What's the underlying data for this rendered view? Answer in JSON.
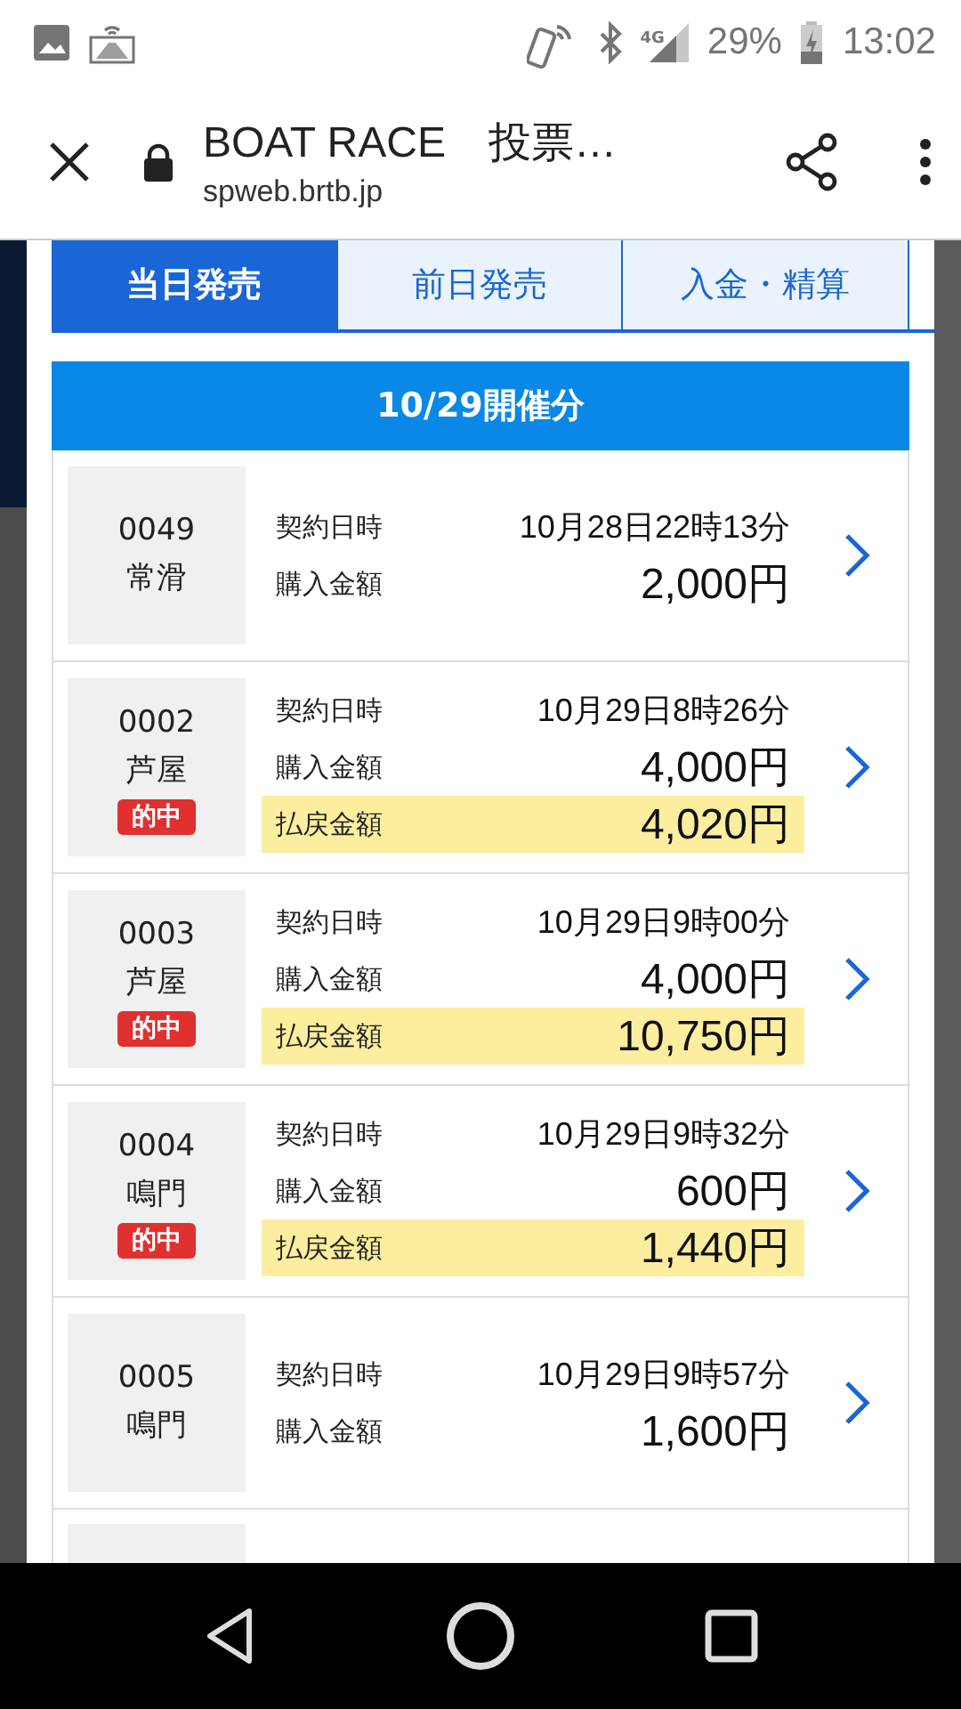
{
  "status_bar": {
    "network": "4G",
    "battery": "29%",
    "time": "13:02"
  },
  "browser": {
    "title": "BOAT RACE　投票…",
    "url": "spweb.brtb.jp"
  },
  "tabs": [
    {
      "label": "当日発売",
      "selected": true
    },
    {
      "label": "前日発売",
      "selected": false
    },
    {
      "label": "入金・精算",
      "selected": false
    }
  ],
  "section_header": "10/29開催分",
  "tickets": [
    {
      "number": "0049",
      "venue": "常滑",
      "rows": [
        {
          "label": "契約日時",
          "value": "10月28日22時13分",
          "kind": "date"
        },
        {
          "label": "購入金額",
          "value": "2,000円",
          "kind": "amount"
        }
      ]
    },
    {
      "number": "0002",
      "venue": "芦屋",
      "badge": "的中",
      "rows": [
        {
          "label": "契約日時",
          "value": "10月29日8時26分",
          "kind": "date"
        },
        {
          "label": "購入金額",
          "value": "4,000円",
          "kind": "amount"
        },
        {
          "label": "払戻金額",
          "value": "4,020円",
          "kind": "payout"
        }
      ]
    },
    {
      "number": "0003",
      "venue": "芦屋",
      "badge": "的中",
      "rows": [
        {
          "label": "契約日時",
          "value": "10月29日9時00分",
          "kind": "date"
        },
        {
          "label": "購入金額",
          "value": "4,000円",
          "kind": "amount"
        },
        {
          "label": "払戻金額",
          "value": "10,750円",
          "kind": "payout"
        }
      ]
    },
    {
      "number": "0004",
      "venue": "鳴門",
      "badge": "的中",
      "rows": [
        {
          "label": "契約日時",
          "value": "10月29日9時32分",
          "kind": "date"
        },
        {
          "label": "購入金額",
          "value": "600円",
          "kind": "amount"
        },
        {
          "label": "払戻金額",
          "value": "1,440円",
          "kind": "payout"
        }
      ]
    },
    {
      "number": "0005",
      "venue": "鳴門",
      "rows": [
        {
          "label": "契約日時",
          "value": "10月29日9時57分",
          "kind": "date"
        },
        {
          "label": "購入金額",
          "value": "1,600円",
          "kind": "amount"
        }
      ]
    }
  ],
  "clipped_next_card": true
}
